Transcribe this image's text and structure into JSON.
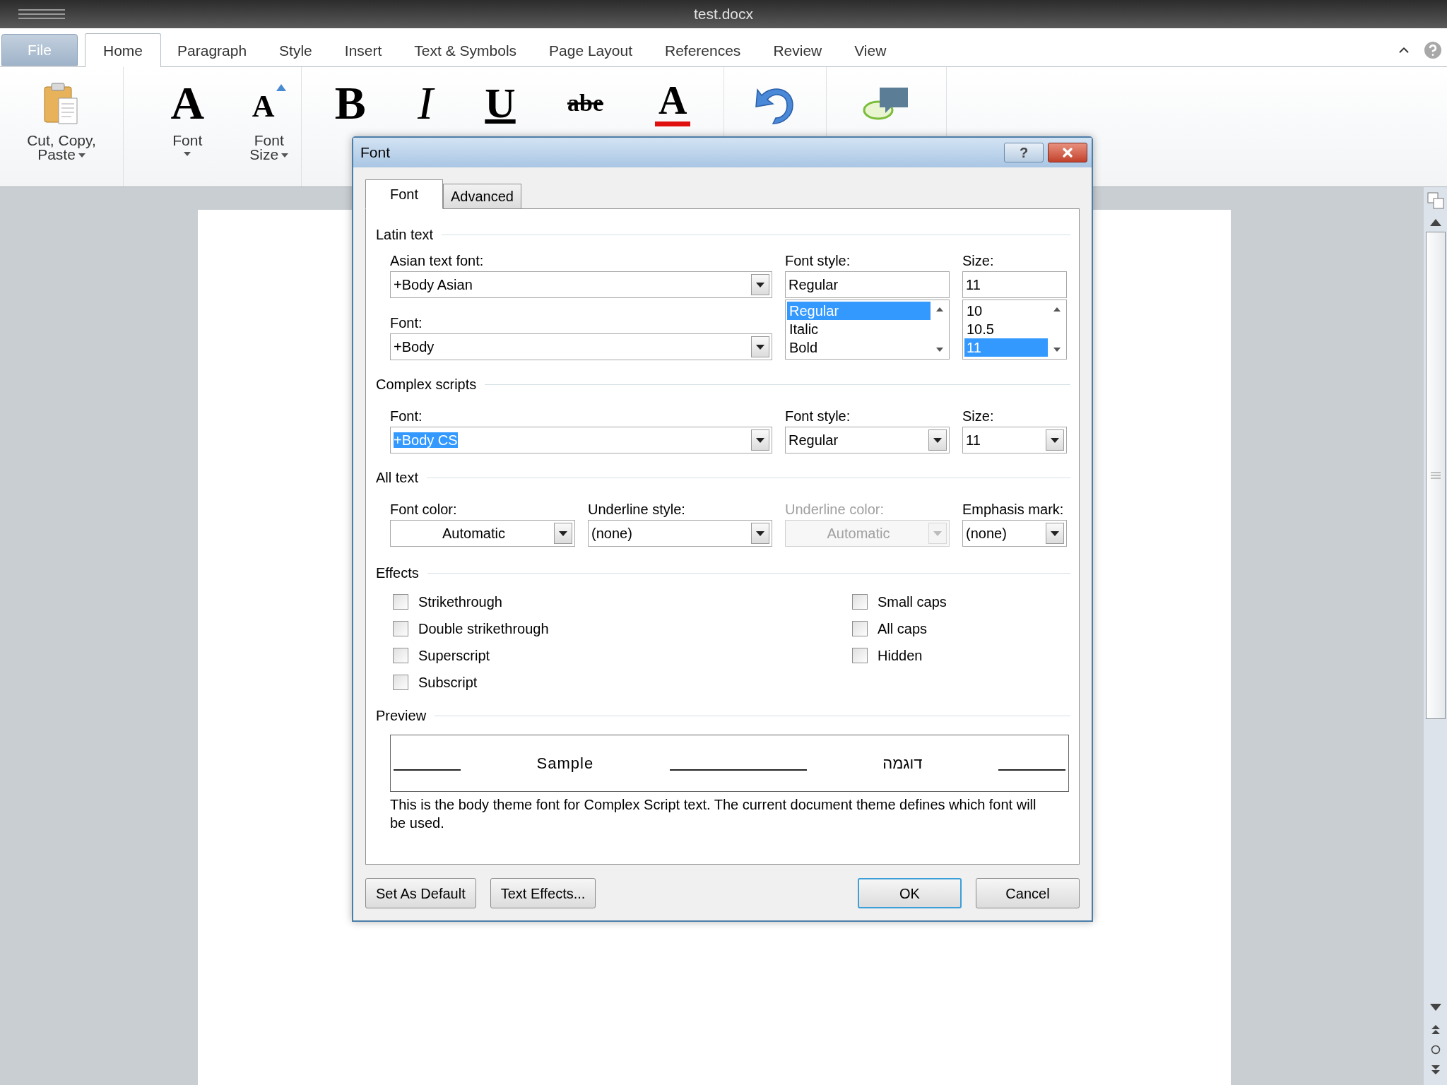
{
  "window": {
    "title": "test.docx"
  },
  "ribbon_tabs": [
    {
      "label": "File",
      "kind": "file",
      "selected": false
    },
    {
      "label": "Home",
      "kind": "tab",
      "selected": true
    },
    {
      "label": "Paragraph",
      "kind": "tab",
      "selected": false
    },
    {
      "label": "Style",
      "kind": "tab",
      "selected": false
    },
    {
      "label": "Insert",
      "kind": "tab",
      "selected": false
    },
    {
      "label": "Text & Symbols",
      "kind": "tab",
      "selected": false
    },
    {
      "label": "Page Layout",
      "kind": "tab",
      "selected": false
    },
    {
      "label": "References",
      "kind": "tab",
      "selected": false
    },
    {
      "label": "Review",
      "kind": "tab",
      "selected": false
    },
    {
      "label": "View",
      "kind": "tab",
      "selected": false
    }
  ],
  "ribbon_groups": [
    {
      "items": [
        {
          "kind": "paste",
          "label": "Cut, Copy, Paste",
          "dropdown": true
        }
      ]
    },
    {
      "items": [
        {
          "kind": "glyph",
          "glyph": "A",
          "label": "Font",
          "dropdown": true
        },
        {
          "kind": "grow",
          "glyph": "A",
          "label": "Font Size",
          "dropdown": true
        }
      ]
    },
    {
      "items": [
        {
          "kind": "glyph",
          "glyph": "B"
        },
        {
          "kind": "italic",
          "glyph": "I"
        },
        {
          "kind": "underline",
          "glyph": "U"
        },
        {
          "kind": "strike",
          "glyph": "abe"
        },
        {
          "kind": "color",
          "glyph": "A"
        }
      ]
    },
    {
      "items": [
        {
          "kind": "undo"
        }
      ]
    },
    {
      "items": [
        {
          "kind": "annotate"
        }
      ]
    }
  ],
  "dialog": {
    "title": "Font",
    "help_button": "?",
    "tabs": [
      {
        "label": "Font",
        "selected": true
      },
      {
        "label": "Advanced",
        "selected": false
      }
    ],
    "latin_text": {
      "heading": "Latin text",
      "asian_font": {
        "label": "Asian text font:",
        "value": "+Body Asian"
      },
      "font": {
        "label": "Font:",
        "value": "+Body"
      },
      "font_style": {
        "label": "Font style:",
        "value": "Regular",
        "options": [
          {
            "text": "Regular",
            "selected": true
          },
          {
            "text": "Italic",
            "selected": false
          },
          {
            "text": "Bold",
            "selected": false
          }
        ]
      },
      "size": {
        "label": "Size:",
        "value": "11",
        "options": [
          {
            "text": "10",
            "selected": false
          },
          {
            "text": "10.5",
            "selected": false
          },
          {
            "text": "11",
            "selected": true
          }
        ]
      }
    },
    "complex_scripts": {
      "heading": "Complex scripts",
      "font": {
        "label": "Font:",
        "value": "+Body CS",
        "highlighted": true
      },
      "font_style": {
        "label": "Font style:",
        "value": "Regular",
        "highlighted": false
      },
      "size": {
        "label": "Size:",
        "value": "11",
        "highlighted": false
      }
    },
    "all_text": {
      "heading": "All text",
      "fields": [
        {
          "label": "Font color:",
          "value": "Automatic",
          "kind": "color",
          "disabled": false
        },
        {
          "label": "Underline style:",
          "value": "(none)",
          "kind": "list",
          "disabled": false
        },
        {
          "label": "Underline color:",
          "value": "Automatic",
          "kind": "color",
          "disabled": true
        },
        {
          "label": "Emphasis mark:",
          "value": "(none)",
          "kind": "list",
          "disabled": false
        }
      ]
    },
    "effects": {
      "heading": "Effects",
      "left": [
        {
          "label": "Strikethrough",
          "checked": false
        },
        {
          "label": "Double strikethrough",
          "checked": false
        },
        {
          "label": "Superscript",
          "checked": false
        },
        {
          "label": "Subscript",
          "checked": false
        }
      ],
      "right": [
        {
          "label": "Small caps",
          "checked": false
        },
        {
          "label": "All caps",
          "checked": false
        },
        {
          "label": "Hidden",
          "checked": false
        }
      ]
    },
    "preview": {
      "heading": "Preview",
      "samples": [
        "Sample",
        "דוגמה"
      ],
      "description": "This is the body theme font for Complex Script text. The current document theme defines which font will be used."
    },
    "left_buttons": [
      {
        "label": "Set As Default",
        "default": false
      },
      {
        "label": "Text Effects...",
        "default": false
      }
    ],
    "right_buttons": [
      {
        "label": "OK",
        "default": true
      },
      {
        "label": "Cancel",
        "default": false
      }
    ]
  }
}
